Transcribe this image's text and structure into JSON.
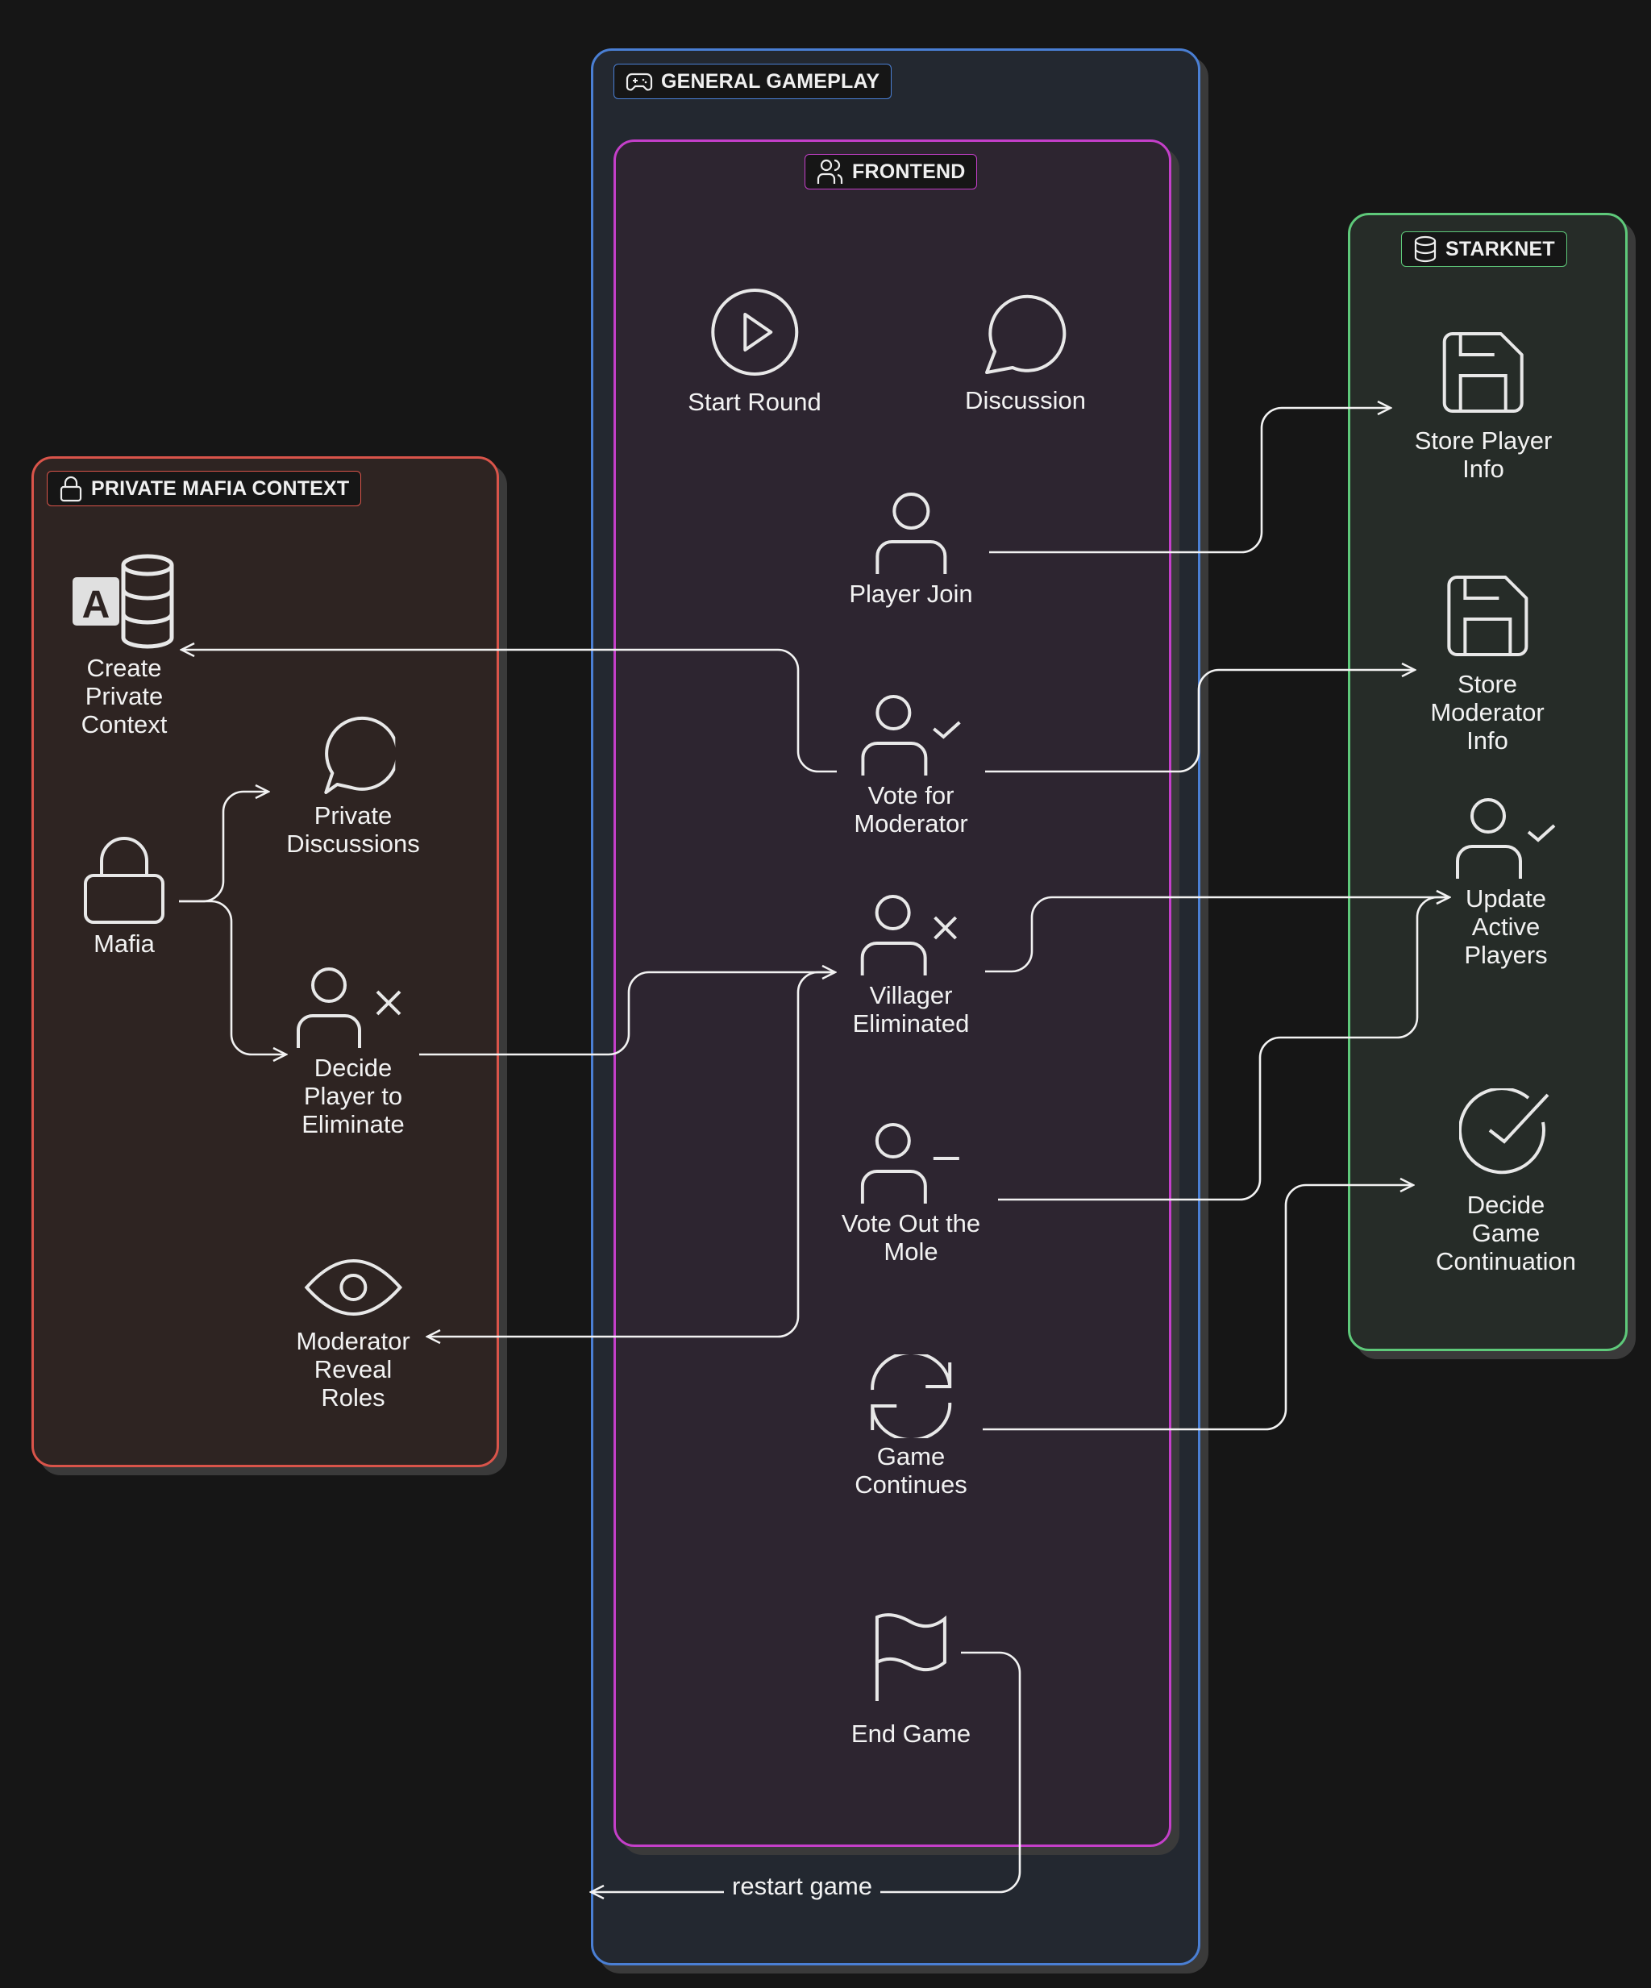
{
  "groups": {
    "mafia": {
      "title": "PRIVATE MAFIA CONTEXT",
      "icon": "lock-icon",
      "color": "#d9544a"
    },
    "gameplay": {
      "title": "GENERAL GAMEPLAY",
      "icon": "gamepad-icon",
      "color": "#4a7fd4"
    },
    "frontend": {
      "title": "FRONTEND",
      "icon": "users-icon",
      "color": "#c43fc9"
    },
    "starknet": {
      "title": "STARKNET",
      "icon": "database-icon",
      "color": "#5ec97a"
    }
  },
  "nodes": {
    "create_private_context": {
      "label": "Create\nPrivate\nContext",
      "icon": "access-database-icon"
    },
    "mafia": {
      "label": "Mafia",
      "icon": "lock-icon"
    },
    "private_discussions": {
      "label": "Private\nDiscussions",
      "icon": "chat-bubble-icon"
    },
    "decide_player_to_eliminate": {
      "label": "Decide\nPlayer to\nEliminate",
      "icon": "user-x-icon"
    },
    "moderator_reveal_roles": {
      "label": "Moderator\nReveal\nRoles",
      "icon": "eye-icon"
    },
    "start_round": {
      "label": "Start Round",
      "icon": "play-circle-icon"
    },
    "discussion": {
      "label": "Discussion",
      "icon": "chat-bubble-icon"
    },
    "player_join": {
      "label": "Player Join",
      "icon": "user-icon"
    },
    "vote_for_moderator": {
      "label": "Vote for\nModerator",
      "icon": "user-check-icon"
    },
    "villager_eliminated": {
      "label": "Villager\nEliminated",
      "icon": "user-x-icon"
    },
    "vote_out_the_mole": {
      "label": "Vote Out the\nMole",
      "icon": "user-minus-icon"
    },
    "game_continues": {
      "label": "Game\nContinues",
      "icon": "refresh-icon"
    },
    "end_game": {
      "label": "End Game",
      "icon": "flag-icon"
    },
    "store_player_info": {
      "label": "Store Player\nInfo",
      "icon": "save-icon"
    },
    "store_moderator_info": {
      "label": "Store\nModerator\nInfo",
      "icon": "save-icon"
    },
    "update_active_players": {
      "label": "Update\nActive\nPlayers",
      "icon": "user-check-icon"
    },
    "decide_game_continuation": {
      "label": "Decide\nGame\nContinuation",
      "icon": "check-circle-icon"
    }
  },
  "edges": [
    {
      "from": "player_join",
      "to": "store_player_info",
      "label": ""
    },
    {
      "from": "vote_for_moderator",
      "to": "create_private_context",
      "label": ""
    },
    {
      "from": "vote_for_moderator",
      "to": "store_moderator_info",
      "label": ""
    },
    {
      "from": "mafia",
      "to": "private_discussions",
      "label": ""
    },
    {
      "from": "mafia",
      "to": "decide_player_to_eliminate",
      "label": ""
    },
    {
      "from": "decide_player_to_eliminate",
      "to": "villager_eliminated",
      "label": ""
    },
    {
      "from": "villager_eliminated",
      "to": "update_active_players",
      "label": ""
    },
    {
      "from": "vote_out_the_mole",
      "to": "update_active_players",
      "label": ""
    },
    {
      "from": "villager_eliminated",
      "to": "moderator_reveal_roles",
      "label": ""
    },
    {
      "from": "game_continues",
      "to": "decide_game_continuation",
      "label": ""
    },
    {
      "from": "end_game",
      "to": "general_gameplay",
      "label": "restart game"
    }
  ]
}
